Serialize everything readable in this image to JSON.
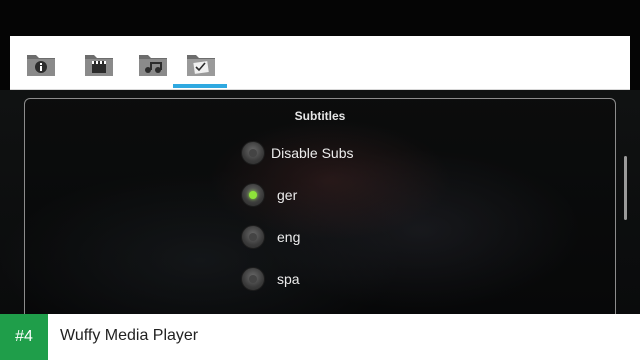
{
  "toolbar": {
    "tabs": [
      {
        "icon": "info-folder-icon"
      },
      {
        "icon": "clapper-folder-icon"
      },
      {
        "icon": "audio-folder-icon"
      },
      {
        "icon": "subtitle-folder-icon",
        "active": true
      }
    ],
    "accent": "#2ea8e0"
  },
  "panel": {
    "title": "Subtitles",
    "options": [
      {
        "label": "Disable Subs",
        "selected": false
      },
      {
        "label": "ger",
        "selected": true
      },
      {
        "label": "eng",
        "selected": false
      },
      {
        "label": "spa",
        "selected": false
      }
    ]
  },
  "footer": {
    "badge": "#4",
    "app_name": "Wuffy Media Player",
    "badge_color": "#1f9e4a"
  }
}
